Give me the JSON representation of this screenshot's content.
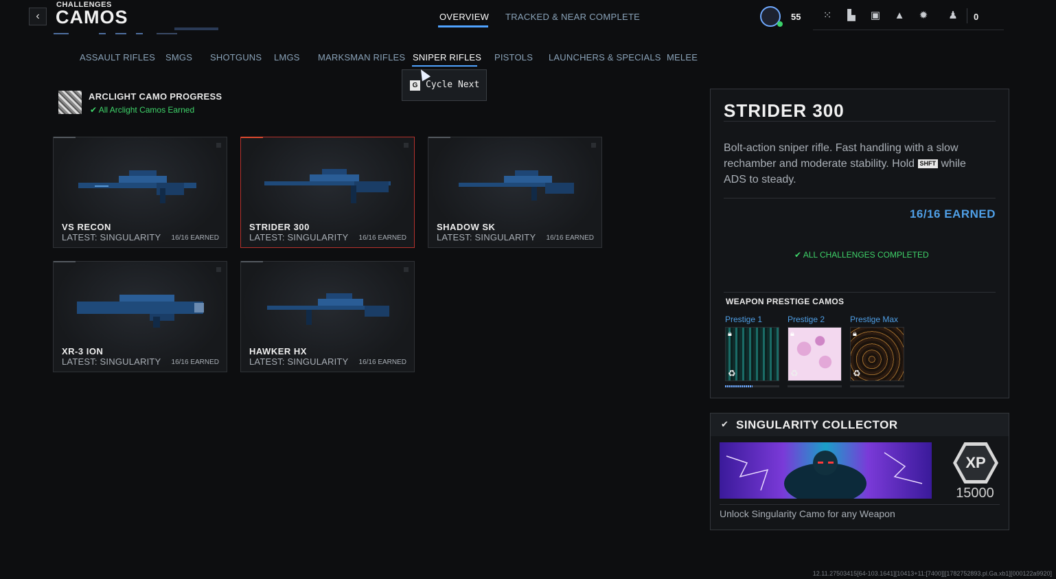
{
  "header": {
    "back_label": "‹",
    "breadcrumb": "CHALLENGES",
    "title": "CAMOS",
    "tabs": [
      {
        "label": "OVERVIEW",
        "active": true
      },
      {
        "label": "TRACKED & NEAR COMPLETE",
        "active": false
      }
    ],
    "level": "55",
    "friends_count": "0"
  },
  "categories": [
    {
      "label": "ASSAULT RIFLES",
      "active": false
    },
    {
      "label": "SMGS",
      "active": false
    },
    {
      "label": "SHOTGUNS",
      "active": false
    },
    {
      "label": "LMGS",
      "active": false
    },
    {
      "label": "MARKSMAN RIFLES",
      "active": false
    },
    {
      "label": "SNIPER RIFLES",
      "active": true
    },
    {
      "label": "PISTOLS",
      "active": false
    },
    {
      "label": "LAUNCHERS & SPECIALS",
      "active": false
    },
    {
      "label": "MELEE",
      "active": false
    }
  ],
  "tooltip": {
    "key": "G",
    "text": "Cycle Next"
  },
  "progress": {
    "title": "ARCLIGHT CAMO PROGRESS",
    "status": "✔ All Arclight Camos Earned"
  },
  "weapons": [
    {
      "name": "VS RECON",
      "latest": "LATEST: SINGULARITY",
      "earned": "16/16 EARNED",
      "selected": false
    },
    {
      "name": "STRIDER 300",
      "latest": "LATEST: SINGULARITY",
      "earned": "16/16 EARNED",
      "selected": true
    },
    {
      "name": "SHADOW SK",
      "latest": "LATEST: SINGULARITY",
      "earned": "16/16 EARNED",
      "selected": false
    },
    {
      "name": "XR-3 ION",
      "latest": "LATEST: SINGULARITY",
      "earned": "16/16 EARNED",
      "selected": false
    },
    {
      "name": "HAWKER HX",
      "latest": "LATEST: SINGULARITY",
      "earned": "16/16 EARNED",
      "selected": false
    }
  ],
  "detail": {
    "title": "STRIDER 300",
    "desc_before": "Bolt-action sniper rifle. Fast handling with a slow rechamber and moderate stability. Hold ",
    "desc_key": "SHFT",
    "desc_after": " while ADS to steady.",
    "earned": "16/16 EARNED",
    "complete": "✔ ALL CHALLENGES COMPLETED",
    "prestige_title": "WEAPON PRESTIGE CAMOS",
    "prestige": [
      {
        "label": "Prestige 1",
        "progress": 0.5
      },
      {
        "label": "Prestige 2",
        "progress": 0
      },
      {
        "label": "Prestige Max",
        "progress": 0
      }
    ]
  },
  "collector": {
    "title": "SINGULARITY COLLECTOR",
    "xp_label": "XP",
    "xp_value": "15000",
    "desc": "Unlock Singularity Camo for any Weapon"
  },
  "build_info": "12.11.27503415[64-103.1641][10413+11:[7400]][1782752893.pl.Ga.xb1][000122a9920]",
  "colors": {
    "accent": "#4f9fe6",
    "success": "#3fd46a",
    "selected_border": "#b8322d"
  }
}
